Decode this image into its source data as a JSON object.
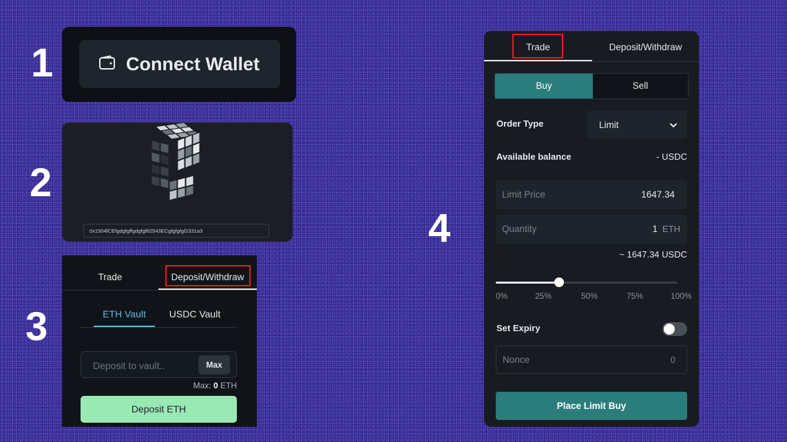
{
  "steps": {
    "one": "1",
    "two": "2",
    "three": "3",
    "four": "4"
  },
  "panel1": {
    "button_label": "Connect Wallet",
    "icon": "wallet-icon"
  },
  "panel2": {
    "address": "0x1504fCEfgdgfgffgdgfgf82543ECgfgfgfgf2331a3",
    "image": "rubiks-cube-hand-image"
  },
  "panel3": {
    "tabs": [
      "Trade",
      "Deposit/Withdraw"
    ],
    "active_tab": "Deposit/Withdraw",
    "vault_tabs": [
      "ETH Vault",
      "USDC Vault"
    ],
    "active_vault": "ETH Vault",
    "deposit_placeholder": "Deposit to vault..",
    "max_button": "Max",
    "max_prefix": "Max:",
    "max_value": "0",
    "max_unit": "ETH",
    "deposit_button": "Deposit ETH"
  },
  "panel4": {
    "tabs": [
      "Trade",
      "Deposit/Withdraw"
    ],
    "active_tab": "Trade",
    "buy_label": "Buy",
    "sell_label": "Sell",
    "order_type_label": "Order Type",
    "order_type_value": "Limit",
    "available_balance_label": "Available balance",
    "available_balance_value": "- USDC",
    "limit_price_placeholder": "Limit Price",
    "limit_price_value": "1647.34",
    "quantity_placeholder": "Quantity",
    "quantity_value": "1",
    "quantity_unit": "ETH",
    "approx_total": "~ 1647.34 USDC",
    "slider_ticks": [
      "0%",
      "25%",
      "50%",
      "75%",
      "100%"
    ],
    "slider_fraction": 0.35,
    "set_expiry_label": "Set Expiry",
    "set_expiry_on": false,
    "nonce_placeholder": "Nonce",
    "nonce_value": "0",
    "place_button": "Place Limit Buy"
  },
  "colors": {
    "background": "#4a3fb0",
    "accent_teal": "#2b7d7c",
    "deposit_green": "#9ae8b3",
    "vault_active": "#5fb8e6",
    "highlight_red": "#e41c1c"
  }
}
